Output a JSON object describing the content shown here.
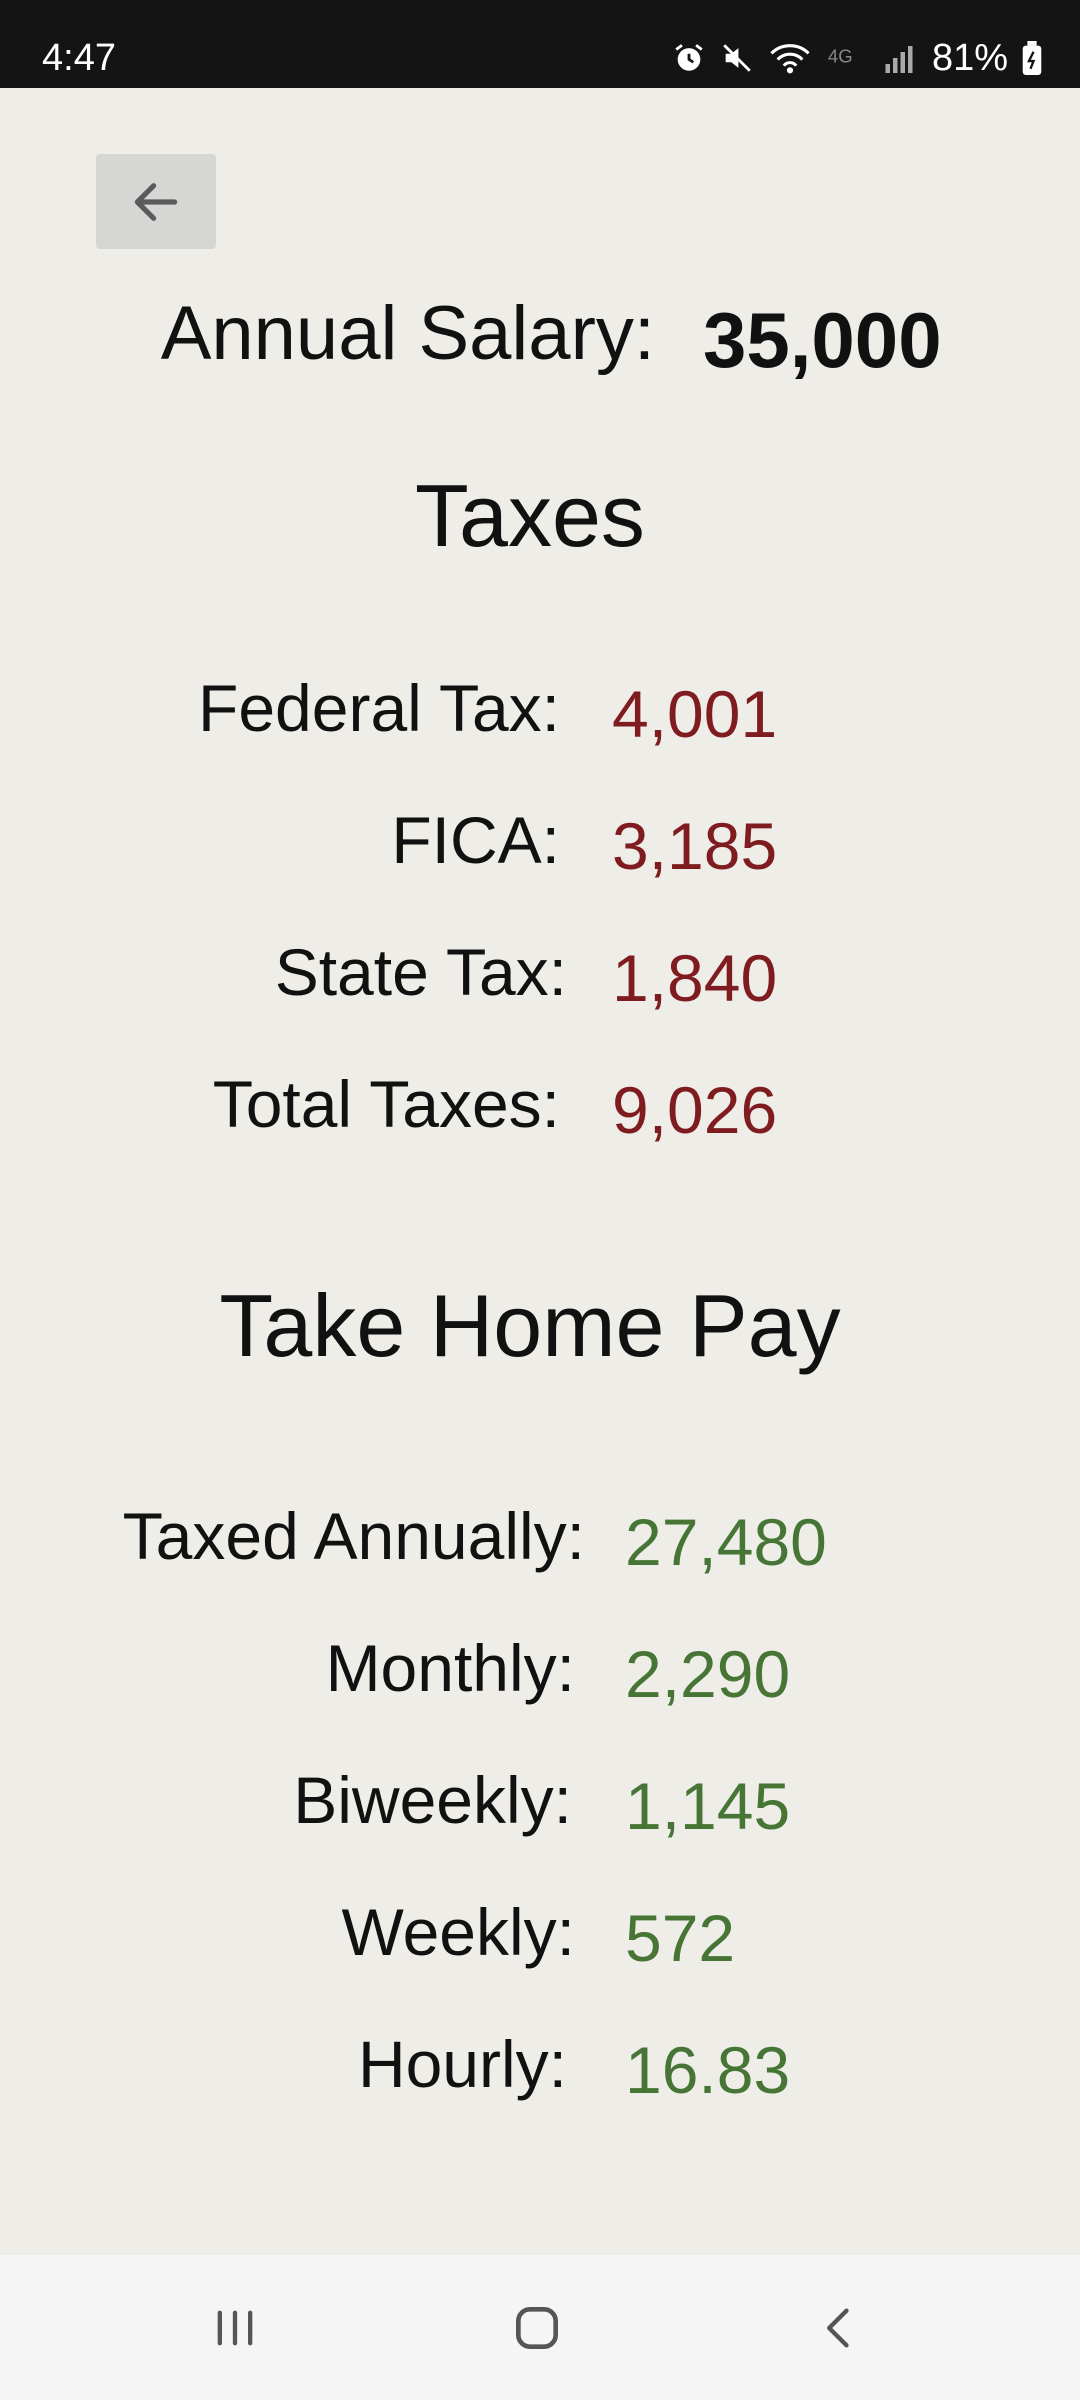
{
  "status_bar": {
    "time": "4:47",
    "battery": "81%",
    "icons": [
      "alarm-icon",
      "mute-icon",
      "wifi-icon",
      "4g-icon",
      "signal-icon",
      "battery-icon"
    ]
  },
  "header": {
    "back_icon": "arrow-left-icon"
  },
  "salary": {
    "label": "Annual Salary:",
    "value": "35,000"
  },
  "taxes": {
    "title": "Taxes",
    "rows": [
      {
        "label": "Federal Tax:",
        "value": "4,001"
      },
      {
        "label": "FICA:",
        "value": "3,185"
      },
      {
        "label": "State Tax:",
        "value": "1,840"
      },
      {
        "label": "Total Taxes:",
        "value": "9,026"
      }
    ]
  },
  "take_home": {
    "title": "Take Home Pay",
    "rows": [
      {
        "label": "Taxed Annually:",
        "value": "27,480"
      },
      {
        "label": "Monthly:",
        "value": "2,290"
      },
      {
        "label": "Biweekly:",
        "value": "1,145"
      },
      {
        "label": "Weekly:",
        "value": "572"
      },
      {
        "label": "Hourly:",
        "value": "16.83"
      }
    ]
  },
  "colors": {
    "tax_value": "#7e1c1f",
    "pay_value": "#467535",
    "background": "#efede8"
  },
  "nav": {
    "icons": [
      "recents-icon",
      "home-icon",
      "back-icon"
    ]
  }
}
